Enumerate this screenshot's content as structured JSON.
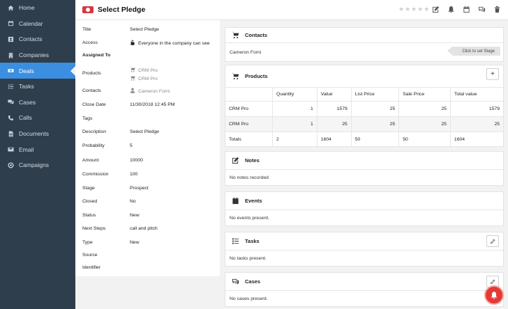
{
  "sidebar": {
    "items": [
      {
        "label": "Home",
        "icon": "home-icon"
      },
      {
        "label": "Calendar",
        "icon": "calendar-icon"
      },
      {
        "label": "Contacts",
        "icon": "contacts-icon"
      },
      {
        "label": "Companies",
        "icon": "building-icon"
      },
      {
        "label": "Deals",
        "icon": "money-icon",
        "active": true
      },
      {
        "label": "Tasks",
        "icon": "tasks-icon"
      },
      {
        "label": "Cases",
        "icon": "comments-icon"
      },
      {
        "label": "Calls",
        "icon": "phone-icon"
      },
      {
        "label": "Documents",
        "icon": "file-icon"
      },
      {
        "label": "Email",
        "icon": "envelope-icon"
      },
      {
        "label": "Campaigns",
        "icon": "bullseye-icon"
      }
    ]
  },
  "header": {
    "title": "Select Pledge",
    "rating_stars": 5,
    "rating_value": 0
  },
  "details": {
    "title": {
      "label": "Title",
      "value": "Select Pledge"
    },
    "access": {
      "label": "Access",
      "value": "Everyone in the company can see"
    },
    "assigned_to": {
      "label": "Assigned To"
    },
    "products": {
      "label": "Products",
      "values": [
        "CRM Pro",
        "CRM Pro"
      ]
    },
    "contacts": {
      "label": "Contacts",
      "value": "Cameron Forni"
    },
    "close_date": {
      "label": "Close Date",
      "value": "11/30/2018 12:45 PM"
    },
    "tags": {
      "label": "Tags"
    },
    "description": {
      "label": "Description",
      "value": "Select Pledge"
    },
    "probability": {
      "label": "Probability",
      "value": "5"
    },
    "amount": {
      "label": "Amount",
      "value": "10000"
    },
    "commission": {
      "label": "Commission",
      "value": "100"
    },
    "stage": {
      "label": "Stage",
      "value": "Prospect"
    },
    "closed": {
      "label": "Closed",
      "value": "No"
    },
    "status": {
      "label": "Status",
      "value": "New"
    },
    "next_steps": {
      "label": "Next Steps",
      "value": "call and pitch"
    },
    "type": {
      "label": "Type",
      "value": "New"
    },
    "source": {
      "label": "Source"
    },
    "identifier": {
      "label": "Identifier"
    }
  },
  "cards": {
    "contacts": {
      "title": "Contacts",
      "name": "Cameron Forni",
      "stage_button": "Click to set Stage"
    },
    "products": {
      "title": "Products",
      "add_label": "+",
      "columns": [
        "",
        "Quantity",
        "Value",
        "List Price",
        "Sale Price",
        "Total value"
      ],
      "rows": [
        [
          "CRM Pro",
          "1",
          "1579",
          "25",
          "25",
          "1579"
        ],
        [
          "CRM Pro",
          "1",
          "25",
          "25",
          "25",
          "25"
        ]
      ],
      "totals": [
        "Totals",
        "2",
        "1604",
        "50",
        "50",
        "1604"
      ]
    },
    "notes": {
      "title": "Notes",
      "empty": "No notes recorded"
    },
    "events": {
      "title": "Events",
      "empty": "No events present."
    },
    "tasks": {
      "title": "Tasks",
      "empty": "No tasks present."
    },
    "cases": {
      "title": "Cases",
      "empty": "No cases present."
    }
  },
  "colors": {
    "sidebar_bg": "#2f3e4c",
    "active_nav": "#3b8ee0",
    "deal_badge": "#d9363e",
    "notification": "#e53935"
  }
}
